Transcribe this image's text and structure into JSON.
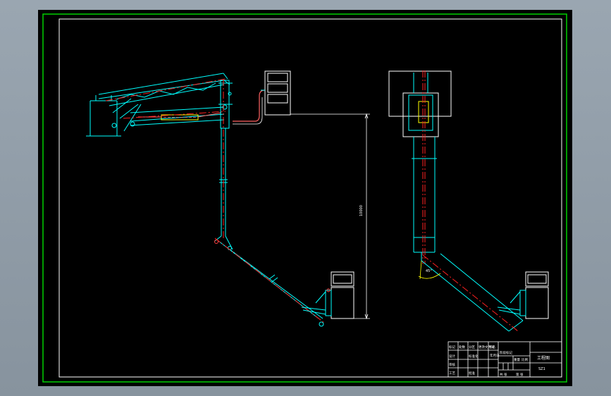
{
  "drawing": {
    "dimension_label": "10000",
    "angle_label": "45°",
    "title_block": {
      "drawing_title": "工程图",
      "cells": [
        "标记",
        "处数",
        "分区",
        "更改文件号",
        "签名",
        "年月日",
        "阶段标记",
        "重量",
        "比例",
        "设计",
        "标准化",
        "审核",
        "工艺",
        "批准"
      ],
      "drawing_code": "SZ1",
      "sheet_info": [
        "共 张",
        "第 张"
      ]
    }
  },
  "colors": {
    "background": "#000000",
    "frame": "#ffffff",
    "outer_frame": "#00d000",
    "structure": "#00ffff",
    "centerline": "#ff2020",
    "cylinder": "#ffff00",
    "pipe": "#ff6060"
  }
}
